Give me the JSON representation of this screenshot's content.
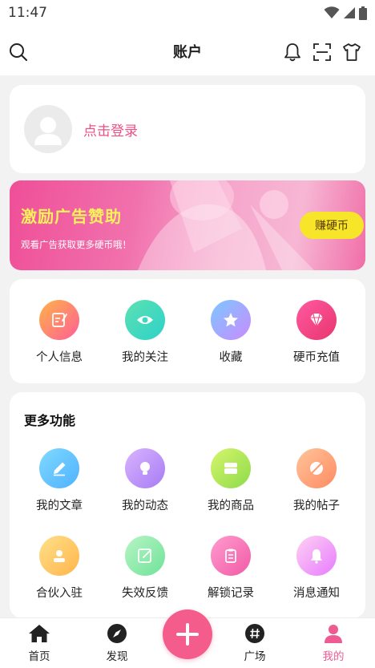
{
  "status_bar": {
    "time": "11:47"
  },
  "header": {
    "title": "账户"
  },
  "login": {
    "text": "点击登录"
  },
  "banner": {
    "title": "激励广告赞助",
    "subtitle": "观看广告获取更多硬币哦！",
    "button": "赚硬币"
  },
  "quick_actions": [
    {
      "label": "个人信息",
      "icon": "edit-note-icon",
      "gradient": [
        "#ffb347",
        "#ff5e97"
      ]
    },
    {
      "label": "我的关注",
      "icon": "eye-icon",
      "gradient": [
        "#5ce1b2",
        "#2ed1c9"
      ]
    },
    {
      "label": "收藏",
      "icon": "star-icon",
      "gradient": [
        "#7cc8ff",
        "#c98bff"
      ]
    },
    {
      "label": "硬币充值",
      "icon": "diamond-icon",
      "gradient": [
        "#ff5aa0",
        "#e8356f"
      ]
    }
  ],
  "more": {
    "title": "更多功能",
    "items": [
      {
        "label": "我的文章",
        "icon": "pencil-icon",
        "gradient": [
          "#7fd9ff",
          "#4fb2ff"
        ]
      },
      {
        "label": "我的动态",
        "icon": "bulb-icon",
        "gradient": [
          "#d8b4ff",
          "#a77bf3"
        ]
      },
      {
        "label": "我的商品",
        "icon": "box-icon",
        "gradient": [
          "#d6f56b",
          "#8edb4b"
        ]
      },
      {
        "label": "我的帖子",
        "icon": "compass-off-icon",
        "gradient": [
          "#ffc59a",
          "#ff8a62"
        ]
      },
      {
        "label": "合伙入驻",
        "icon": "partner-icon",
        "gradient": [
          "#ffe08a",
          "#ffb54a"
        ]
      },
      {
        "label": "失效反馈",
        "icon": "feedback-icon",
        "gradient": [
          "#b7f5c3",
          "#6fe29a"
        ]
      },
      {
        "label": "解锁记录",
        "icon": "clipboard-icon",
        "gradient": [
          "#ff9ccf",
          "#f15aa6"
        ]
      },
      {
        "label": "消息通知",
        "icon": "bell-icon",
        "gradient": [
          "#ffd1f2",
          "#e77bff"
        ]
      }
    ]
  },
  "bottom_nav": [
    {
      "label": "首页",
      "icon": "home-icon"
    },
    {
      "label": "发现",
      "icon": "compass-icon"
    },
    {
      "label": "广场",
      "icon": "hashtag-icon"
    },
    {
      "label": "我的",
      "icon": "user-icon"
    }
  ],
  "colors": {
    "accent": "#ee5a92",
    "banner_title": "#f7f25a",
    "earn_button": "#f7e52a"
  }
}
